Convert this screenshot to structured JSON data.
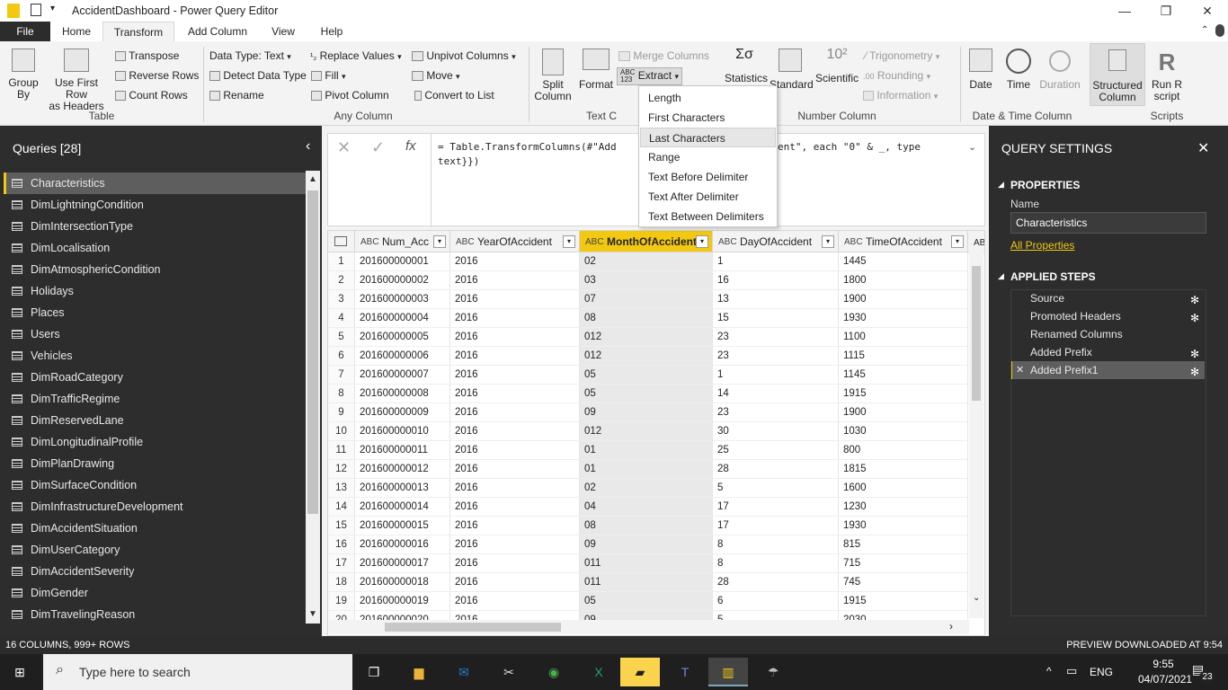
{
  "window": {
    "title": "AccidentDashboard - Power Query Editor"
  },
  "tabs": [
    "File",
    "Home",
    "Transform",
    "Add Column",
    "View",
    "Help"
  ],
  "ribbon": {
    "table": {
      "group": "Table",
      "group_by": "Group\nBy",
      "first_row": "Use First Row\nas Headers",
      "transpose": "Transpose",
      "reverse": "Reverse Rows",
      "count": "Count Rows"
    },
    "anycol": {
      "group": "Any Column",
      "datatype": "Data Type: Text",
      "detect": "Detect Data Type",
      "rename": "Rename",
      "replace": "Replace Values",
      "fill": "Fill",
      "pivot": "Pivot Column",
      "unpivot": "Unpivot Columns",
      "move": "Move",
      "convert": "Convert to List"
    },
    "text": {
      "group": "Text C",
      "split": "Split\nColumn",
      "format": "Format",
      "merge": "Merge Columns",
      "extract": "Extract"
    },
    "number": {
      "group": "Number Column",
      "statistics": "Statistics",
      "standard": "Standard",
      "scientific": "Scientific",
      "trig": "Trigonometry",
      "rounding": "Rounding",
      "information": "Information"
    },
    "datetime": {
      "group": "Date & Time Column",
      "date": "Date",
      "time": "Time",
      "duration": "Duration"
    },
    "structured": {
      "label": "Structured\nColumn"
    },
    "scripts": {
      "group": "Scripts",
      "run_r": "Run R\nscript"
    }
  },
  "extract_menu": [
    "Length",
    "First Characters",
    "Last Characters",
    "Range",
    "Text Before Delimiter",
    "Text After Delimiter",
    "Text Between Delimiters"
  ],
  "queries": {
    "header": "Queries [28]",
    "items": [
      "Characteristics",
      "DimLightningCondition",
      "DimIntersectionType",
      "DimLocalisation",
      "DimAtmosphericCondition",
      "Holidays",
      "Places",
      "Users",
      "Vehicles",
      "DimRoadCategory",
      "DimTrafficRegime",
      "DimReservedLane",
      "DimLongitudinalProfile",
      "DimPlanDrawing",
      "DimSurfaceCondition",
      "DimInfrastructureDevelopment",
      "DimAccidentSituation",
      "DimUserCategory",
      "DimAccidentSeverity",
      "DimGender",
      "DimTravelingReason"
    ]
  },
  "formula": {
    "line1_a": "= Table.TransformColumns(#\"Add",
    "line1_b": "ent\", each \"0\" & _, type",
    "line2": "text}})"
  },
  "grid": {
    "type_label": "ABC",
    "columns": [
      "Num_Acc",
      "YearOfAccident",
      "MonthOfAccident",
      "DayOfAccident",
      "TimeOfAccident"
    ],
    "rows": [
      [
        "1",
        "201600000001",
        "2016",
        "02",
        "1",
        "1445"
      ],
      [
        "2",
        "201600000002",
        "2016",
        "03",
        "16",
        "1800"
      ],
      [
        "3",
        "201600000003",
        "2016",
        "07",
        "13",
        "1900"
      ],
      [
        "4",
        "201600000004",
        "2016",
        "08",
        "15",
        "1930"
      ],
      [
        "5",
        "201600000005",
        "2016",
        "012",
        "23",
        "1100"
      ],
      [
        "6",
        "201600000006",
        "2016",
        "012",
        "23",
        "1115"
      ],
      [
        "7",
        "201600000007",
        "2016",
        "05",
        "1",
        "1145"
      ],
      [
        "8",
        "201600000008",
        "2016",
        "05",
        "14",
        "1915"
      ],
      [
        "9",
        "201600000009",
        "2016",
        "09",
        "23",
        "1900"
      ],
      [
        "10",
        "201600000010",
        "2016",
        "012",
        "30",
        "1030"
      ],
      [
        "11",
        "201600000011",
        "2016",
        "01",
        "25",
        "800"
      ],
      [
        "12",
        "201600000012",
        "2016",
        "01",
        "28",
        "1815"
      ],
      [
        "13",
        "201600000013",
        "2016",
        "02",
        "5",
        "1600"
      ],
      [
        "14",
        "201600000014",
        "2016",
        "04",
        "17",
        "1230"
      ],
      [
        "15",
        "201600000015",
        "2016",
        "08",
        "17",
        "1930"
      ],
      [
        "16",
        "201600000016",
        "2016",
        "09",
        "8",
        "815"
      ],
      [
        "17",
        "201600000017",
        "2016",
        "011",
        "8",
        "715"
      ],
      [
        "18",
        "201600000018",
        "2016",
        "011",
        "28",
        "745"
      ],
      [
        "19",
        "201600000019",
        "2016",
        "05",
        "6",
        "1915"
      ],
      [
        "20",
        "201600000020",
        "2016",
        "09",
        "5",
        "2030"
      ]
    ]
  },
  "settings": {
    "title": "QUERY SETTINGS",
    "properties": "PROPERTIES",
    "name_label": "Name",
    "name_value": "Characteristics",
    "all_props": "All Properties",
    "applied": "APPLIED STEPS",
    "steps": [
      "Source",
      "Promoted Headers",
      "Renamed Columns",
      "Added Prefix",
      "Added Prefix1"
    ]
  },
  "status": {
    "left": "16 COLUMNS, 999+ ROWS",
    "right": "PREVIEW DOWNLOADED AT 9:54"
  },
  "taskbar": {
    "search": "Type here to search",
    "lang": "ENG",
    "time": "9:55",
    "date": "04/07/2021",
    "notif": "23"
  }
}
